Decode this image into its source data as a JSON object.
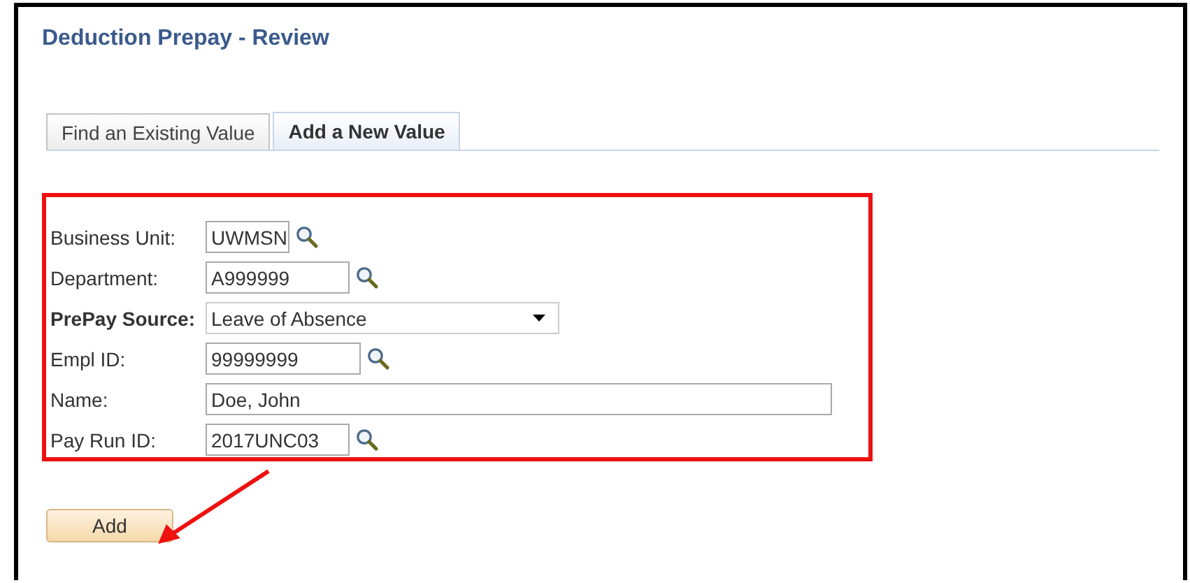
{
  "page": {
    "title": "Deduction Prepay - Review"
  },
  "tabs": [
    {
      "label": "Find an Existing Value",
      "selected": false
    },
    {
      "label": "Add a New Value",
      "selected": true
    }
  ],
  "fields": [
    {
      "label": "Business Unit:",
      "kind": "lookup",
      "value": "UWMSN",
      "required": false
    },
    {
      "label": "Department:",
      "kind": "lookup",
      "value": "A999999",
      "required": false
    },
    {
      "label": "PrePay Source:",
      "kind": "select",
      "value": "Leave of Absence",
      "required": true
    },
    {
      "label": "Empl ID:",
      "kind": "lookup",
      "value": "99999999",
      "required": false
    },
    {
      "label": "Name:",
      "kind": "text",
      "value": "Doe, John",
      "required": false
    },
    {
      "label": "Pay Run ID:",
      "kind": "lookup",
      "value": "2017UNC03",
      "required": false
    }
  ],
  "add_button": {
    "label": "Add"
  }
}
